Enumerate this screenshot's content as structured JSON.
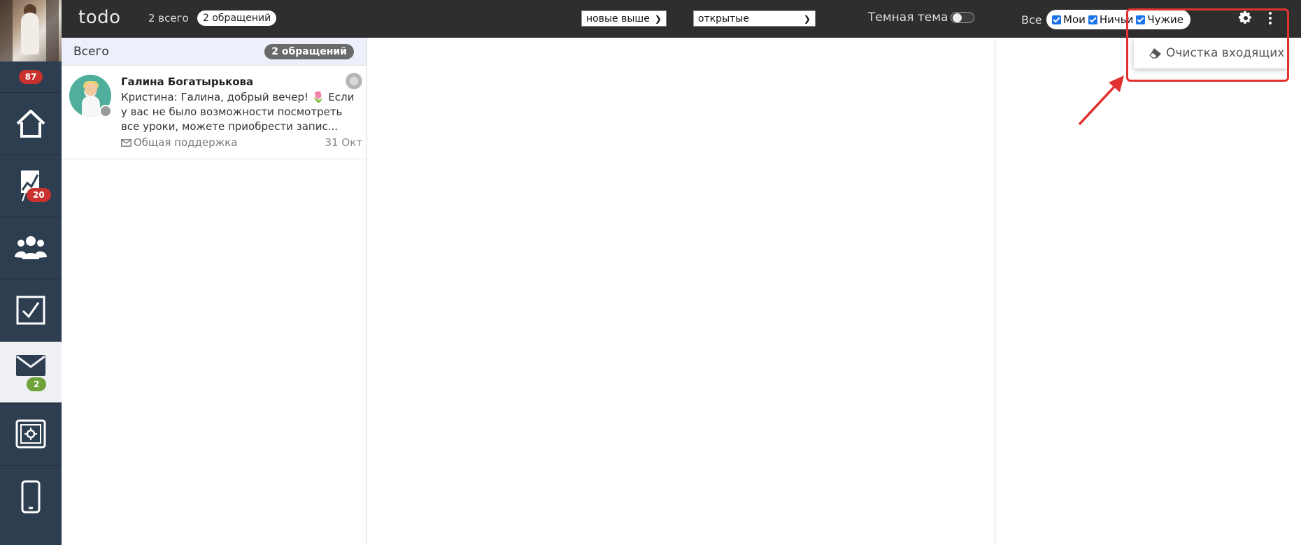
{
  "sidebar": {
    "top_badge": "87",
    "items": [
      {
        "name": "home",
        "badge": ""
      },
      {
        "name": "analytics",
        "badge": "20"
      },
      {
        "name": "clients",
        "badge": ""
      },
      {
        "name": "tasks",
        "badge": ""
      },
      {
        "name": "mail",
        "badge": "2"
      },
      {
        "name": "safe",
        "badge": ""
      },
      {
        "name": "mobile",
        "badge": ""
      }
    ]
  },
  "topbar": {
    "logo": "todo",
    "total": "2 всего",
    "pill": "2 обращений",
    "sort_select": "новые выше",
    "status_select": "открытые",
    "dark_theme_label": "Темная тема",
    "all_label": "Все",
    "filters": [
      {
        "label": "Мои",
        "checked": true
      },
      {
        "label": "Ничьи",
        "checked": true
      },
      {
        "label": "Чужие",
        "checked": true
      }
    ]
  },
  "list": {
    "header_title": "Всего",
    "header_count": "2 обращений",
    "tickets": [
      {
        "name": "Галина Богатырькова",
        "preview": "Кристина: Галина, добрый вечер! 🌷 Если у вас не было возможности посмотреть все уроки, можете приобрести запис...",
        "channel": "Общая поддержка",
        "date": "31 Окт"
      }
    ]
  },
  "menu": {
    "clear_inbox": "Очистка входящих"
  },
  "colors": {
    "sidebar_bg": "#2d3e50",
    "topbar_bg": "#2e2e2e",
    "badge_red": "#c8312d",
    "badge_green": "#6fa33a",
    "annotation": "#e0322e"
  }
}
